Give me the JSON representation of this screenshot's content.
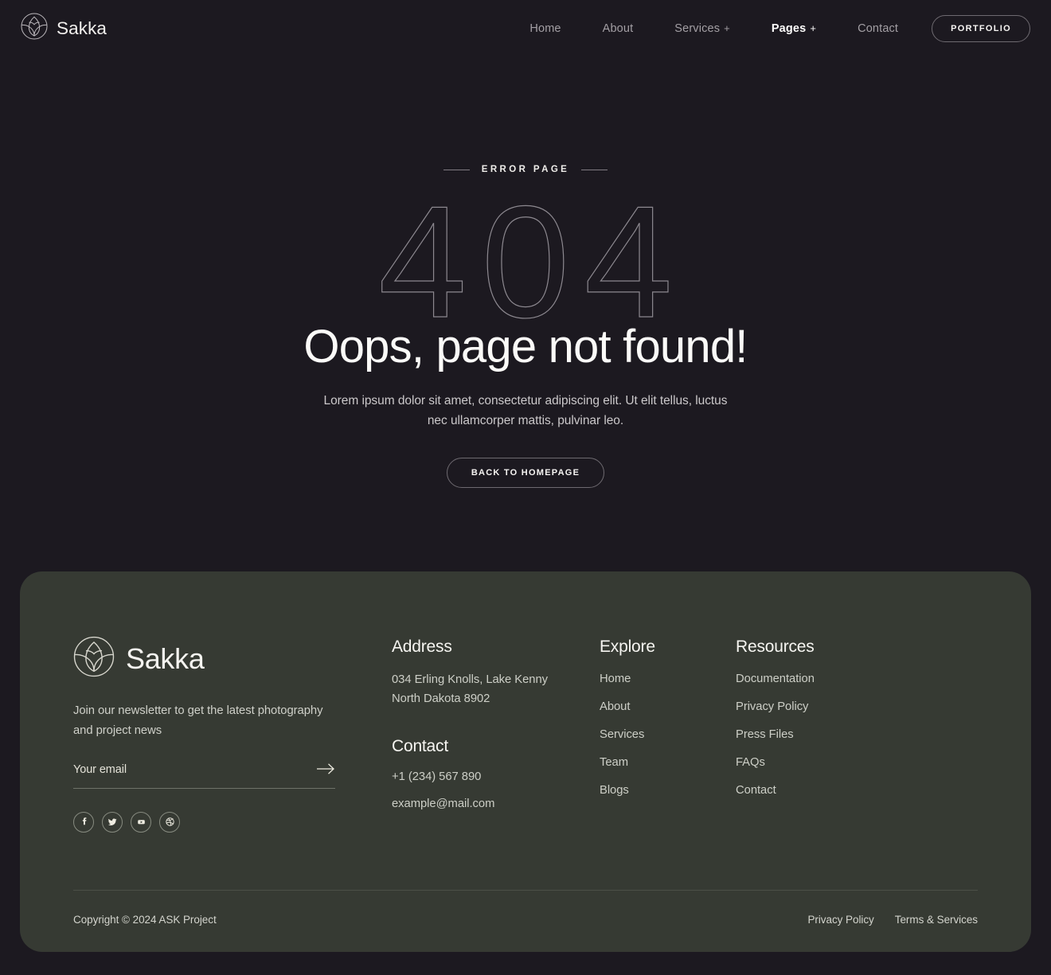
{
  "brand": {
    "name": "Sakka",
    "logo_icon": "lotus-flower-circle-icon"
  },
  "nav": {
    "items": [
      {
        "label": "Home",
        "has_dropdown": false,
        "active": false
      },
      {
        "label": "About",
        "has_dropdown": false,
        "active": false
      },
      {
        "label": "Services",
        "has_dropdown": true,
        "active": false
      },
      {
        "label": "Pages",
        "has_dropdown": true,
        "active": true
      },
      {
        "label": "Contact",
        "has_dropdown": false,
        "active": false
      }
    ],
    "cta_label": "PORTFOLIO",
    "dropdown_glyph": "+"
  },
  "hero": {
    "eyebrow": "ERROR PAGE",
    "code": "404",
    "title": "Oops, page not found!",
    "description": "Lorem ipsum dolor sit amet, consectetur adipiscing elit. Ut elit tellus, luctus nec ullamcorper mattis, pulvinar leo.",
    "button_label": "BACK TO HOMEPAGE"
  },
  "footer": {
    "brand_name": "Sakka",
    "newsletter_text": "Join our newsletter to get the latest photography and project news",
    "email_placeholder": "Your email",
    "email_value": "",
    "submit_icon": "arrow-right-icon",
    "socials": [
      {
        "name": "facebook-icon",
        "label": "Facebook"
      },
      {
        "name": "twitter-icon",
        "label": "Twitter"
      },
      {
        "name": "youtube-icon",
        "label": "YouTube"
      },
      {
        "name": "dribbble-icon",
        "label": "Dribbble"
      }
    ],
    "address": {
      "title": "Address",
      "line1": "034 Erling Knolls, Lake Kenny",
      "line2": "North Dakota 8902"
    },
    "contact": {
      "title": "Contact",
      "phone": "+1 (234) 567 890",
      "email": "example@mail.com"
    },
    "explore": {
      "title": "Explore",
      "links": [
        "Home",
        "About",
        "Services",
        "Team",
        "Blogs"
      ]
    },
    "resources": {
      "title": "Resources",
      "links": [
        "Documentation",
        "Privacy Policy",
        "Press Files",
        "FAQs",
        "Contact"
      ]
    },
    "copyright": "Copyright © 2024 ASK Project",
    "legal": [
      "Privacy Policy",
      "Terms & Services"
    ]
  },
  "colors": {
    "page_bg": "#1c1920",
    "footer_bg": "#363a33",
    "text_primary": "#f6f4f2",
    "text_muted": "#a39fa4",
    "outline": "#6e6a70"
  }
}
